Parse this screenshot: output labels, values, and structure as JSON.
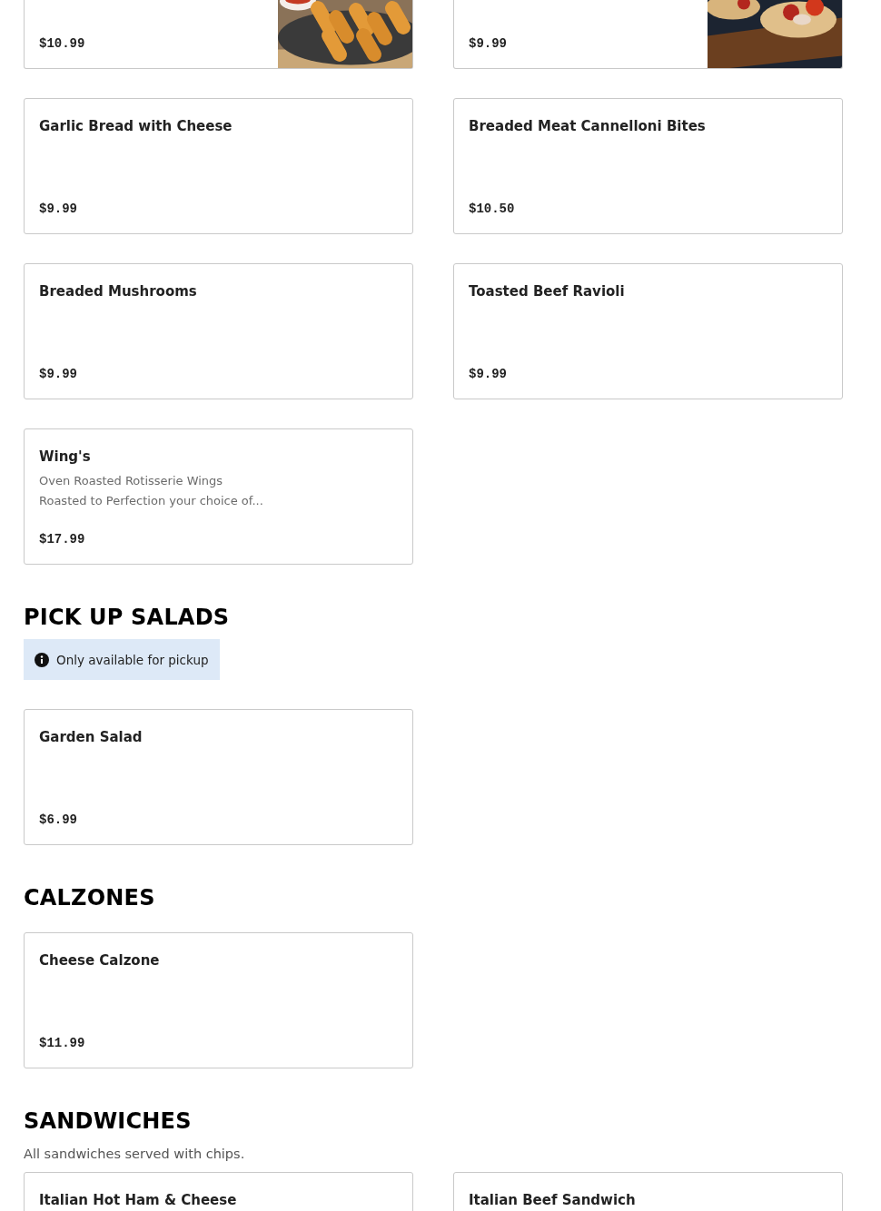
{
  "sections": [
    {
      "items": [
        {
          "price": "$10.99",
          "kind": "picture"
        },
        {
          "price": "$9.99",
          "kind": "picture"
        },
        {
          "name": "Garlic Bread with Cheese",
          "price": "$9.99"
        },
        {
          "name": "Breaded Meat Cannelloni Bites",
          "price": "$10.50"
        },
        {
          "name": "Breaded Mushrooms",
          "price": "$9.99"
        },
        {
          "name": "Toasted Beef Ravioli",
          "price": "$9.99"
        },
        {
          "name": "Wing's",
          "description": [
            "Oven Roasted Rotisserie Wings",
            "Roasted to Perfection your choice of..."
          ],
          "price": "$17.99"
        }
      ]
    },
    {
      "heading": "PICK UP SALADS",
      "note": "Only available for pickup",
      "items": [
        {
          "name": "Garden Salad",
          "price": "$6.99"
        }
      ]
    },
    {
      "heading": "CALZONES",
      "items": [
        {
          "name": "Cheese Calzone",
          "price": "$11.99"
        }
      ]
    },
    {
      "heading": "SANDWICHES",
      "subtitle": "All sandwiches served with chips.",
      "items": [
        {
          "name": "Italian Hot Ham & Cheese"
        },
        {
          "name": "Italian Beef Sandwich"
        }
      ]
    }
  ]
}
